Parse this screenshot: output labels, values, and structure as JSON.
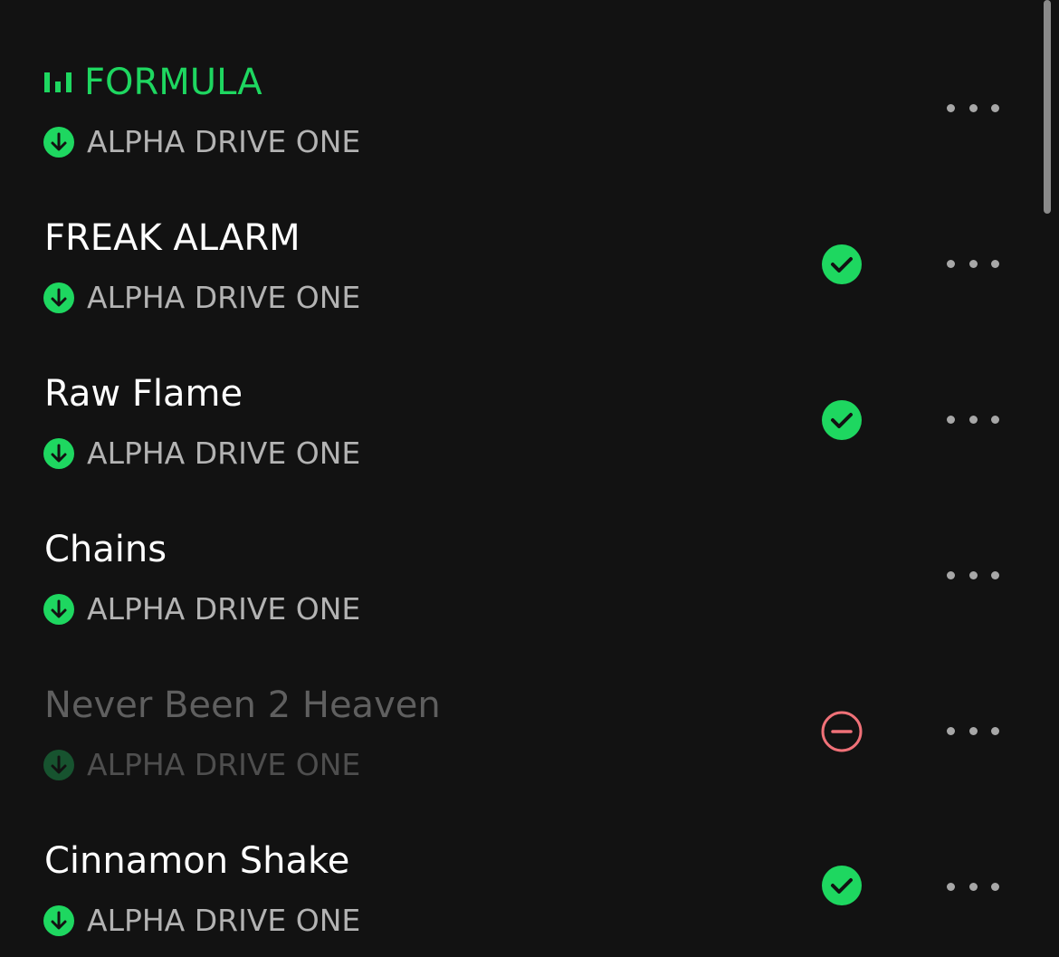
{
  "colors": {
    "accent": "#1ed760",
    "background": "#121212",
    "unavailable": "#f07178"
  },
  "tracks": [
    {
      "title": "FORMULA",
      "artist": "ALPHA DRIVE ONE",
      "state": "playing",
      "status_icon": ""
    },
    {
      "title": "FREAK ALARM",
      "artist": "ALPHA DRIVE ONE",
      "state": "normal",
      "status_icon": "added-check-icon"
    },
    {
      "title": "Raw Flame",
      "artist": "ALPHA DRIVE ONE",
      "state": "normal",
      "status_icon": "added-check-icon"
    },
    {
      "title": "Chains",
      "artist": "ALPHA DRIVE ONE",
      "state": "normal",
      "status_icon": ""
    },
    {
      "title": "Never Been 2 Heaven",
      "artist": "ALPHA DRIVE ONE",
      "state": "unavailable",
      "status_icon": "unavailable-icon"
    },
    {
      "title": "Cinnamon Shake",
      "artist": "ALPHA DRIVE ONE",
      "state": "normal",
      "status_icon": "added-check-icon"
    }
  ],
  "icons": {
    "playing": "equalizer-icon",
    "downloaded": "download-arrow-icon",
    "more": "more-options-icon"
  }
}
